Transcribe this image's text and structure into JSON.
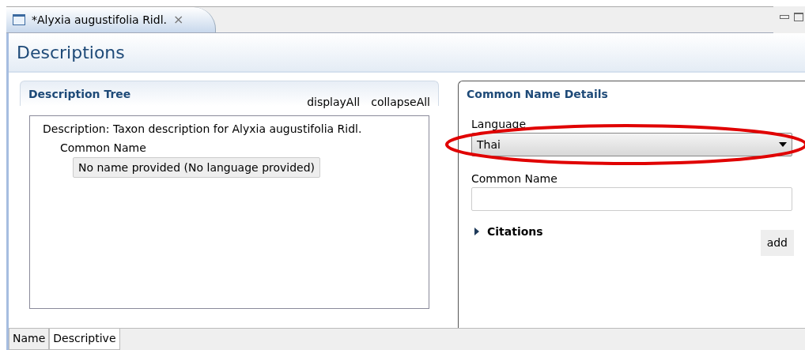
{
  "editor_tab": {
    "title": "*Alyxia augustifolia Ridl.",
    "close": "×"
  },
  "form_title": "Descriptions",
  "tree_section": {
    "title": "Description Tree",
    "actions": [
      "displayAll",
      "collapseAll"
    ],
    "tree": [
      {
        "label": "Description: Taxon description for Alyxia augustifolia Ridl.",
        "selected": false,
        "children": [
          {
            "label": "Common Name",
            "selected": false,
            "children": [
              {
                "label": "No name provided (No language provided)",
                "selected": true
              }
            ]
          }
        ]
      }
    ]
  },
  "details_section": {
    "title": "Common Name Details",
    "fields": [
      {
        "kind": "combo",
        "label": "Language",
        "value": "Thai",
        "highlighted": true
      },
      {
        "kind": "text",
        "label": "Common Name"
      }
    ],
    "citations": {
      "label": "Citations",
      "expanded": false,
      "button": "add"
    }
  },
  "bottom_tabs": [
    {
      "label": "Name",
      "selected": false
    },
    {
      "label": "Descriptive",
      "selected": true
    }
  ]
}
